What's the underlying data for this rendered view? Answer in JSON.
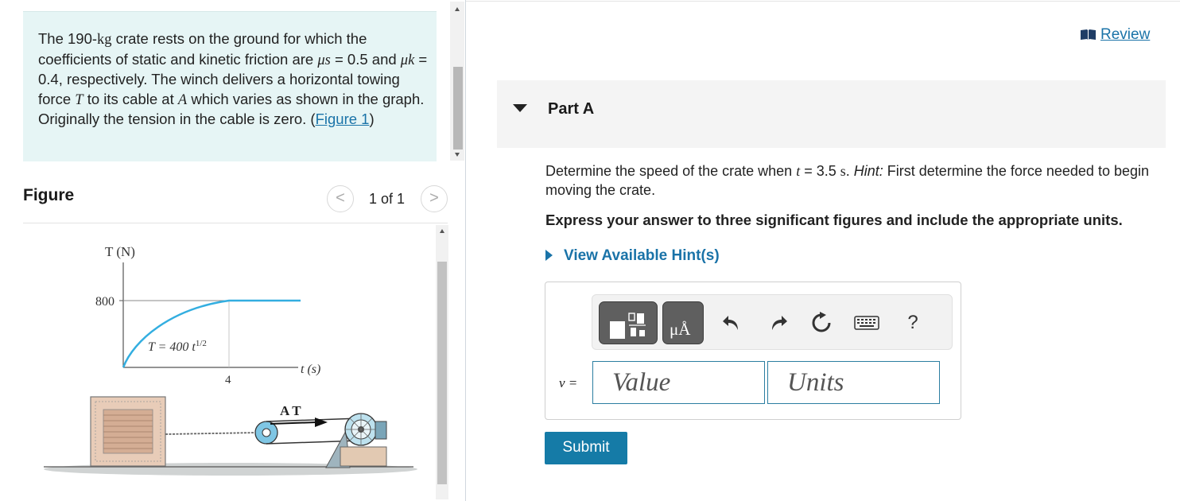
{
  "problem": {
    "line1_a": "The 190-",
    "mass_unit": "kg",
    "line1_b": " crate rests on the ground for which the coefficients of static and kinetic friction are ",
    "mu_s_symbol": "μs",
    "mu_s_value": " = 0.5 and ",
    "mu_k_symbol": "μk",
    "mu_k_value": " = 0.4, respectively. The winch delivers a horizontal towing force ",
    "force_symbol": "T",
    "text_mid": " to its cable at ",
    "point_symbol": "A",
    "text_end": " which varies as shown in the graph. Originally the tension in the cable is zero. (",
    "figure_link": "Figure 1",
    "close_paren": ")"
  },
  "figure": {
    "title": "Figure",
    "counter": "1 of 1",
    "prev_glyph": "<",
    "next_glyph": ">",
    "graph": {
      "y_axis_label": "T (N)",
      "y_tick": "800",
      "curve_label": "T = 400 t",
      "curve_exponent": "1/2",
      "x_tick": "4",
      "x_axis_label": "t (s)",
      "point_labels": "A T"
    }
  },
  "review": {
    "label": "Review"
  },
  "part": {
    "title": "Part A"
  },
  "question": {
    "text_a": "Determine the speed of the crate when ",
    "t_symbol": "t",
    "text_b": " = 3.5 ",
    "unit": "s",
    "text_c": ". ",
    "hint_word": "Hint:",
    "text_d": " First determine the force needed to begin moving the crate."
  },
  "instruction": "Express your answer to three significant figures and include the appropriate units.",
  "hints_link": "View Available Hint(s)",
  "answer": {
    "variable": "v =",
    "value_placeholder": "Value",
    "units_placeholder": "Units",
    "unit_symbol": "μÅ",
    "help": "?"
  },
  "submit_label": "Submit",
  "colors": {
    "accent": "#1a73a8",
    "submit": "#157ba7",
    "problem_bg": "#e6f5f5",
    "curve": "#33aee0"
  }
}
